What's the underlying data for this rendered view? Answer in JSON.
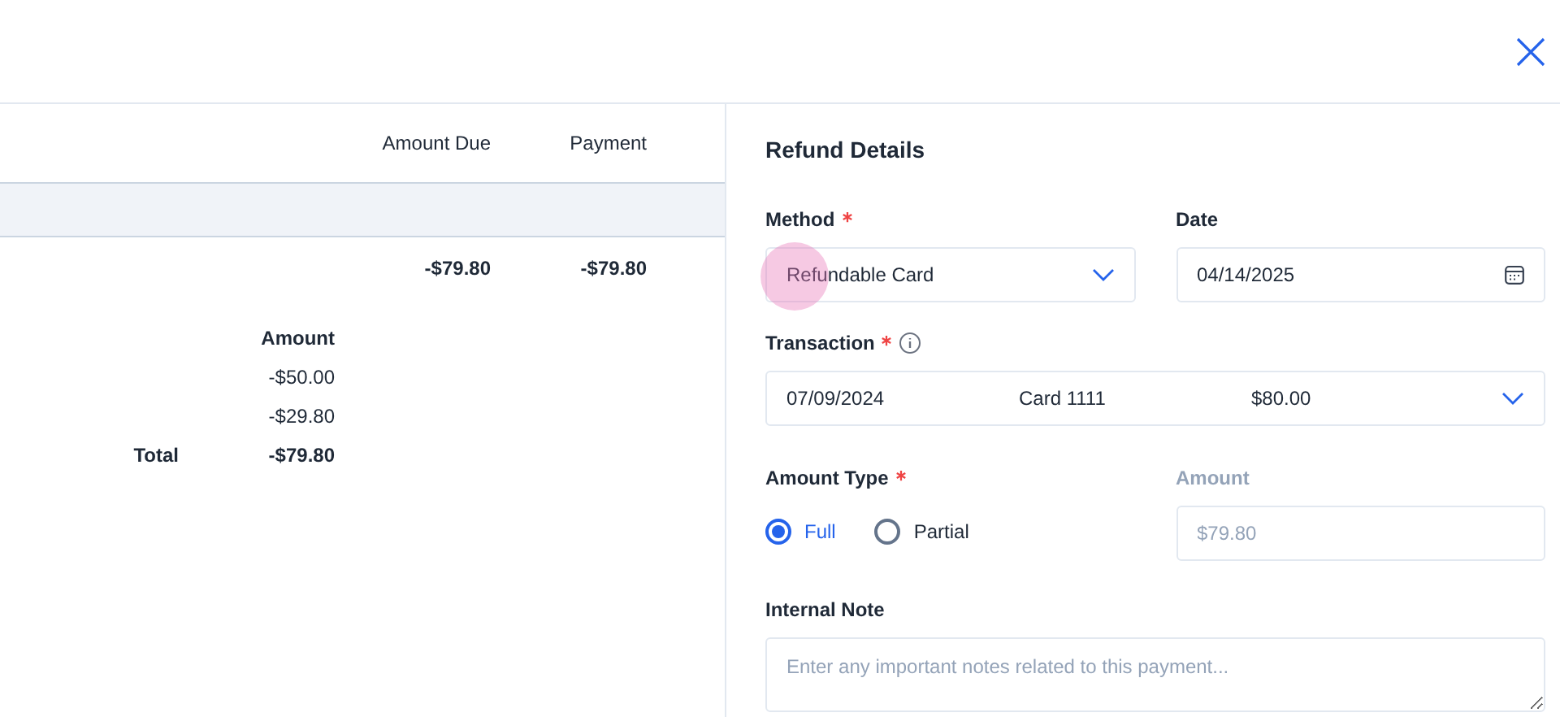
{
  "table": {
    "columns": [
      "Amount Due",
      "Payment"
    ],
    "rows": [
      {
        "amount_due": "-$79.80",
        "payment": "-$79.80"
      }
    ]
  },
  "breakdown": {
    "column": "Amount",
    "amounts": [
      "-$50.00",
      "-$29.80"
    ],
    "total_label": "Total",
    "total": "-$79.80"
  },
  "refund": {
    "title": "Refund Details",
    "method": {
      "label": "Method",
      "required": true,
      "value": "Refundable Card"
    },
    "date": {
      "label": "Date",
      "required": false,
      "value": "04/14/2025"
    },
    "transaction": {
      "label": "Transaction",
      "required": true,
      "date": "07/09/2024",
      "card": "Card 1111",
      "amount": "$80.00"
    },
    "amount_type": {
      "label": "Amount Type",
      "required": true,
      "options": [
        {
          "label": "Full",
          "selected": true
        },
        {
          "label": "Partial",
          "selected": false
        }
      ]
    },
    "amount": {
      "label": "Amount",
      "disabled": true,
      "value": "$79.80"
    },
    "note": {
      "label": "Internal Note",
      "placeholder": "Enter any important notes related to this payment..."
    }
  }
}
